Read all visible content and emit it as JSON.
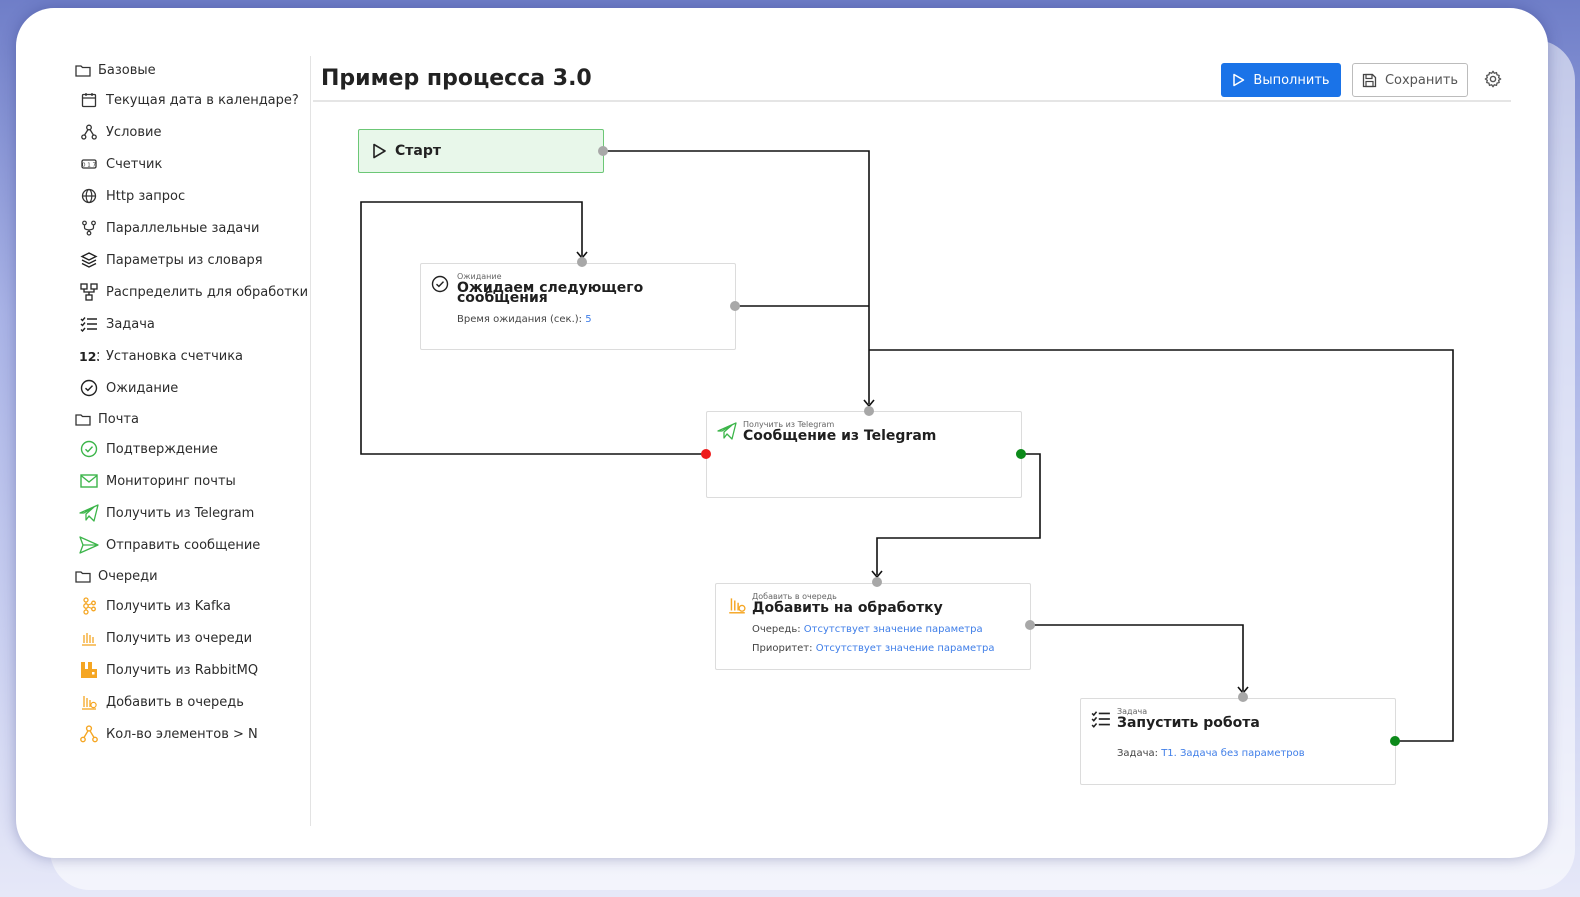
{
  "sidebar": {
    "items": [
      {
        "label": "Базовые",
        "icon": "folder-icon",
        "folder": true
      },
      {
        "label": "Текущая дата в календаре?",
        "icon": "calendar-icon"
      },
      {
        "label": "Условие",
        "icon": "condition-icon"
      },
      {
        "label": "Счетчик",
        "icon": "counter-icon"
      },
      {
        "label": "Http запрос",
        "icon": "globe-icon"
      },
      {
        "label": "Параллельные задачи",
        "icon": "fork-icon"
      },
      {
        "label": "Параметры из словаря",
        "icon": "layers-icon"
      },
      {
        "label": "Распределить для обработки",
        "icon": "distribute-icon"
      },
      {
        "label": "Задача",
        "icon": "task-list-icon"
      },
      {
        "label": "Установка счетчика",
        "icon": "numbers-icon"
      },
      {
        "label": "Ожидание",
        "icon": "clock-icon"
      },
      {
        "label": "Почта",
        "icon": "folder-icon",
        "folder": true
      },
      {
        "label": "Подтверждение",
        "icon": "check-circle-icon"
      },
      {
        "label": "Мониторинг почты",
        "icon": "mail-icon"
      },
      {
        "label": "Получить из Telegram",
        "icon": "telegram-icon"
      },
      {
        "label": "Отправить сообщение",
        "icon": "send-icon"
      },
      {
        "label": "Очереди",
        "icon": "folder-icon",
        "folder": true
      },
      {
        "label": "Получить из Kafka",
        "icon": "kafka-icon"
      },
      {
        "label": "Получить из очереди",
        "icon": "queue-get-icon"
      },
      {
        "label": "Получить из RabbitMQ",
        "icon": "rabbitmq-icon"
      },
      {
        "label": "Добавить в очередь",
        "icon": "queue-add-icon"
      },
      {
        "label": "Кол-во элементов > N",
        "icon": "condition-orange-icon"
      }
    ]
  },
  "header": {
    "title": "Пример процесса 3.0",
    "run_label": "Выполнить",
    "save_label": "Сохранить"
  },
  "nodes": {
    "start": {
      "title": "Старт"
    },
    "wait": {
      "type": "Ожидание",
      "title_line1": "Ожидаем следующего",
      "title_line2": "сообщения",
      "prop_label": "Время ожидания (сек.):",
      "prop_value": "5"
    },
    "telegram": {
      "type": "Получить из Telegram",
      "title": "Сообщение из Telegram"
    },
    "queue": {
      "type": "Добавить в очередь",
      "title": "Добавить на обработку",
      "prop1_label": "Очередь:",
      "prop1_value": "Отсутствует значение параметра",
      "prop2_label": "Приоритет:",
      "prop2_value": "Отсутствует значение параметра"
    },
    "robot": {
      "type": "Задача",
      "title": "Запустить робота",
      "prop_label": "Задача:",
      "prop_value": "T1. Задача без параметров"
    }
  },
  "colors": {
    "accent": "#1a73e8",
    "start_bg": "#e8f7ea",
    "start_border": "#6cc776",
    "port_default": "#a8a8a8",
    "port_error": "#ee1c1c",
    "port_success": "#0c8a1a",
    "link": "#3f7ee8",
    "queue_orange": "#f5a623"
  }
}
